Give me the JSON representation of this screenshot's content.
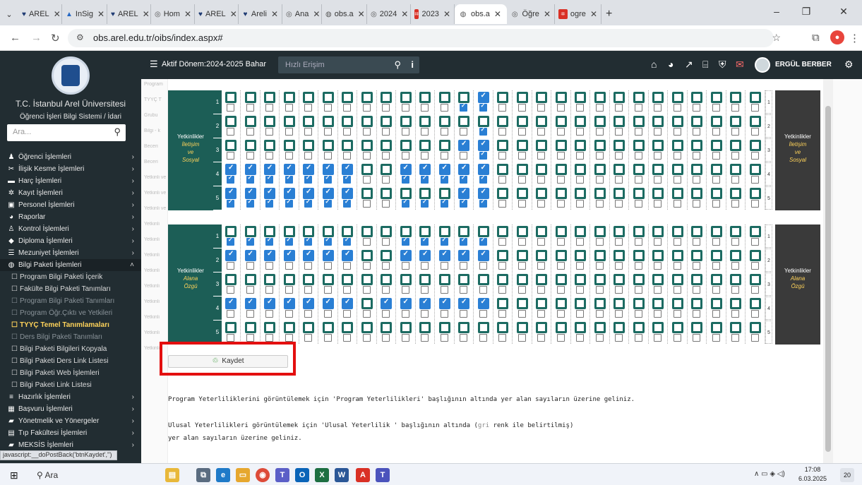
{
  "browser": {
    "tabs": [
      {
        "label": "AREL",
        "icon": "heart-icon",
        "color": "#1f3b73"
      },
      {
        "label": "InSig",
        "icon": "insight-icon",
        "color": "#2568c4"
      },
      {
        "label": "AREL",
        "icon": "heart-icon",
        "color": "#1f3b73"
      },
      {
        "label": "Hom",
        "icon": "arel-icon",
        "color": "#555555"
      },
      {
        "label": "AREL",
        "icon": "heart-icon",
        "color": "#1f3b73"
      },
      {
        "label": "Areli",
        "icon": "heart-icon",
        "color": "#1f3b73"
      },
      {
        "label": "Ana",
        "icon": "arel-icon",
        "color": "#555555"
      },
      {
        "label": "obs.a",
        "icon": "globe-icon",
        "color": "#555555"
      },
      {
        "label": "2024",
        "icon": "arel-icon",
        "color": "#555555"
      },
      {
        "label": "2023",
        "icon": "pdf-icon",
        "color": "#d93025"
      },
      {
        "label": "obs.a",
        "icon": "globe-icon",
        "color": "#555555",
        "active": true
      },
      {
        "label": "Öğre",
        "icon": "arel-icon",
        "color": "#555555"
      },
      {
        "label": "ogre",
        "icon": "pdf-icon",
        "color": "#d93025"
      }
    ],
    "new_tab": "+",
    "url": "obs.arel.edu.tr/oibs/index.aspx#"
  },
  "sidebar": {
    "university": "T.C. İstanbul Arel Üniversitesi",
    "system": "Öğrenci İşleri Bilgi Sistemi / İdari",
    "search_placeholder": "Ara...",
    "items": [
      {
        "label": "Öğrenci İşlemleri",
        "icon": "student-icon"
      },
      {
        "label": "İlişik Kesme İşlemleri",
        "icon": "unlink-icon"
      },
      {
        "label": "Harç İşlemleri",
        "icon": "money-icon"
      },
      {
        "label": "Kayıt İşlemleri",
        "icon": "gear-icon"
      },
      {
        "label": "Personel İşlemleri",
        "icon": "idcard-icon"
      },
      {
        "label": "Raporlar",
        "icon": "pie-icon"
      },
      {
        "label": "Kontrol İşlemleri",
        "icon": "user-check-icon"
      },
      {
        "label": "Diploma İşlemleri",
        "icon": "diploma-icon"
      },
      {
        "label": "Mezuniyet İşlemleri",
        "icon": "list-icon"
      },
      {
        "label": "Bilgi Paketi İşlemleri",
        "icon": "globe-icon"
      }
    ],
    "subitems": [
      {
        "label": "Program Bilgi Paketi İçerik",
        "state": "normal"
      },
      {
        "label": "Fakülte Bilgi Paketi Tanımları",
        "state": "normal"
      },
      {
        "label": "Program Bilgi Paketi Tanımları",
        "state": "dim"
      },
      {
        "label": "Program Öğr.Çıktı ve Yetkileri",
        "state": "dim"
      },
      {
        "label": "TYYÇ Temel Tanımlamaları",
        "state": "selected"
      },
      {
        "label": "Ders Bilgi Paketi Tanımları",
        "state": "dim"
      },
      {
        "label": "Bilgi Paketi Bilgileri Kopyala",
        "state": "normal"
      },
      {
        "label": "Bilgi Paketi Ders Link Listesi",
        "state": "normal"
      },
      {
        "label": "Bilgi Paketi Web İşlemleri",
        "state": "normal"
      },
      {
        "label": "Bilgi Paketi Link Listesi",
        "state": "normal"
      }
    ],
    "items2": [
      {
        "label": "Hazırlık İşlemleri",
        "icon": "bars-icon"
      },
      {
        "label": "Başvuru İşlemleri",
        "icon": "table-icon"
      },
      {
        "label": "Yönetmelik ve Yönergeler",
        "icon": "briefcase-icon"
      },
      {
        "label": "Tıp Fakültesi İşlemleri",
        "icon": "medical-icon"
      },
      {
        "label": "MEKSİS İşlemleri",
        "icon": "briefcase-icon"
      }
    ],
    "js_status": "javascript:__doPostBack('btnKaydet','')"
  },
  "header": {
    "term": "Aktif Dönem:2024-2025 Bahar",
    "quick_access": "Hızlı Erişim",
    "user": "ERGÜL BERBER"
  },
  "grid": {
    "group1": {
      "label_a": "Yetkinlikler",
      "label_b": "İletişim",
      "label_c": "ve",
      "label_d": "Sosyal"
    },
    "group2": {
      "label_a": "Yetkinlikler",
      "label_b": "Alana",
      "label_c": "Özgü"
    },
    "rows1": [
      {
        "n": "1",
        "top": [
          0,
          0,
          0,
          0,
          0,
          0,
          0,
          0,
          0,
          0,
          0,
          0,
          0,
          1,
          0,
          0,
          0,
          0,
          0,
          0,
          0,
          0,
          0,
          0,
          0,
          0,
          0,
          0
        ],
        "bot": [
          0,
          0,
          0,
          0,
          0,
          0,
          0,
          0,
          0,
          0,
          0,
          0,
          1,
          1,
          0,
          0,
          0,
          0,
          0,
          0,
          0,
          0,
          0,
          0,
          0,
          0,
          0,
          0
        ]
      },
      {
        "n": "2",
        "top": [
          0,
          0,
          0,
          0,
          0,
          0,
          0,
          0,
          0,
          0,
          0,
          0,
          0,
          0,
          0,
          0,
          0,
          0,
          0,
          0,
          0,
          0,
          0,
          0,
          0,
          0,
          0,
          0
        ],
        "bot": [
          0,
          0,
          0,
          0,
          0,
          0,
          0,
          0,
          0,
          0,
          0,
          0,
          0,
          1,
          0,
          0,
          0,
          0,
          0,
          0,
          0,
          0,
          0,
          0,
          0,
          0,
          0,
          0
        ]
      },
      {
        "n": "3",
        "top": [
          0,
          0,
          0,
          0,
          0,
          0,
          0,
          0,
          0,
          0,
          0,
          0,
          1,
          1,
          0,
          0,
          0,
          0,
          0,
          0,
          0,
          0,
          0,
          0,
          0,
          0,
          0,
          0
        ],
        "bot": [
          0,
          0,
          0,
          0,
          0,
          0,
          0,
          0,
          0,
          0,
          0,
          0,
          0,
          1,
          0,
          0,
          0,
          0,
          0,
          0,
          0,
          0,
          0,
          0,
          0,
          0,
          0,
          0
        ]
      },
      {
        "n": "4",
        "top": [
          1,
          1,
          1,
          1,
          1,
          1,
          1,
          0,
          0,
          1,
          1,
          1,
          1,
          1,
          0,
          0,
          0,
          0,
          0,
          0,
          0,
          0,
          0,
          0,
          0,
          0,
          0,
          0
        ],
        "bot": [
          1,
          1,
          1,
          1,
          1,
          1,
          1,
          0,
          0,
          1,
          1,
          1,
          1,
          1,
          0,
          0,
          0,
          0,
          0,
          0,
          0,
          0,
          0,
          0,
          0,
          0,
          0,
          0
        ]
      },
      {
        "n": "5",
        "top": [
          1,
          1,
          1,
          1,
          1,
          1,
          1,
          0,
          0,
          0,
          0,
          0,
          1,
          1,
          0,
          0,
          0,
          0,
          0,
          0,
          0,
          0,
          0,
          0,
          0,
          0,
          0,
          0
        ],
        "bot": [
          1,
          1,
          1,
          1,
          1,
          1,
          1,
          0,
          0,
          1,
          1,
          1,
          1,
          1,
          0,
          0,
          0,
          0,
          0,
          0,
          0,
          0,
          0,
          0,
          0,
          0,
          0,
          0
        ]
      }
    ],
    "rows2": [
      {
        "n": "1",
        "top": [
          0,
          0,
          0,
          0,
          0,
          0,
          0,
          0,
          0,
          0,
          0,
          0,
          0,
          0,
          0,
          0,
          0,
          0,
          0,
          0,
          0,
          0,
          0,
          0,
          0,
          0,
          0,
          0
        ],
        "bot": [
          1,
          1,
          1,
          1,
          1,
          1,
          1,
          0,
          0,
          1,
          1,
          1,
          1,
          1,
          0,
          0,
          0,
          0,
          0,
          0,
          0,
          0,
          0,
          0,
          0,
          0,
          0,
          0
        ]
      },
      {
        "n": "2",
        "top": [
          1,
          1,
          1,
          1,
          1,
          1,
          1,
          0,
          0,
          1,
          1,
          1,
          1,
          1,
          0,
          0,
          0,
          0,
          0,
          0,
          0,
          0,
          0,
          0,
          0,
          0,
          0,
          0
        ],
        "bot": [
          0,
          0,
          0,
          0,
          0,
          0,
          0,
          0,
          0,
          0,
          0,
          0,
          0,
          0,
          0,
          0,
          0,
          0,
          0,
          0,
          0,
          0,
          0,
          0,
          0,
          0,
          0,
          0
        ]
      },
      {
        "n": "3",
        "top": [
          0,
          0,
          0,
          0,
          0,
          0,
          0,
          0,
          0,
          0,
          0,
          0,
          0,
          0,
          0,
          0,
          0,
          0,
          0,
          0,
          0,
          0,
          0,
          0,
          0,
          0,
          0,
          0
        ],
        "bot": [
          0,
          0,
          0,
          0,
          0,
          0,
          0,
          0,
          0,
          0,
          0,
          0,
          0,
          0,
          0,
          0,
          0,
          0,
          0,
          0,
          0,
          0,
          0,
          0,
          0,
          0,
          0,
          0
        ]
      },
      {
        "n": "4",
        "top": [
          1,
          1,
          1,
          1,
          1,
          1,
          1,
          0,
          1,
          1,
          1,
          1,
          1,
          1,
          0,
          0,
          0,
          0,
          0,
          0,
          0,
          0,
          0,
          0,
          0,
          0,
          0,
          0
        ],
        "bot": [
          0,
          0,
          0,
          0,
          0,
          0,
          0,
          0,
          0,
          0,
          0,
          0,
          0,
          0,
          0,
          0,
          0,
          0,
          0,
          0,
          0,
          0,
          0,
          0,
          0,
          0,
          0,
          0
        ]
      },
      {
        "n": "5",
        "top": [
          0,
          0,
          0,
          0,
          0,
          0,
          0,
          0,
          0,
          0,
          0,
          0,
          0,
          0,
          0,
          0,
          0,
          0,
          0,
          0,
          0,
          0,
          0,
          0,
          0,
          0,
          0,
          0
        ],
        "bot": [
          0,
          0,
          0,
          0,
          0,
          0,
          0,
          0,
          0,
          0,
          0,
          0,
          0,
          0,
          0,
          0,
          0,
          0,
          0,
          0,
          0,
          0,
          0,
          0,
          0,
          0,
          0,
          0
        ]
      }
    ]
  },
  "left_labels": [
    "Program",
    "TYYÇ T",
    "Grubu",
    "Bilgi - k",
    "Beceri",
    "Beceri",
    "Yetkinli ve Sor",
    "Yetkinli ve Sor",
    "Yetkinli ve Sor",
    "Yetkinli",
    "Yetkinli",
    "Yetkinli",
    "Yetkinli",
    "Yetkinli",
    "Yetkinli",
    "Yetkinli",
    "Yetkinli",
    "Yetkinli"
  ],
  "save_button": "Kaydet",
  "info": {
    "line1": "Program Yeterliliklerini görüntülemek için 'Program Yeterlilikleri' başlığının altında yer alan sayıların üzerine geliniz.",
    "line2_a": "Ulusal Yeterlilikleri görüntülemek için 'Ulusal Yeterlilik ' başlığının altında (",
    "line2_gri": "gri",
    "line2_b": " renk ile belirtilmiş)",
    "line3": "yer alan sayıların üzerine geliniz."
  },
  "taskbar": {
    "search": "Ara",
    "time": "17:08",
    "date": "6.03.2025",
    "notifications": "20"
  }
}
